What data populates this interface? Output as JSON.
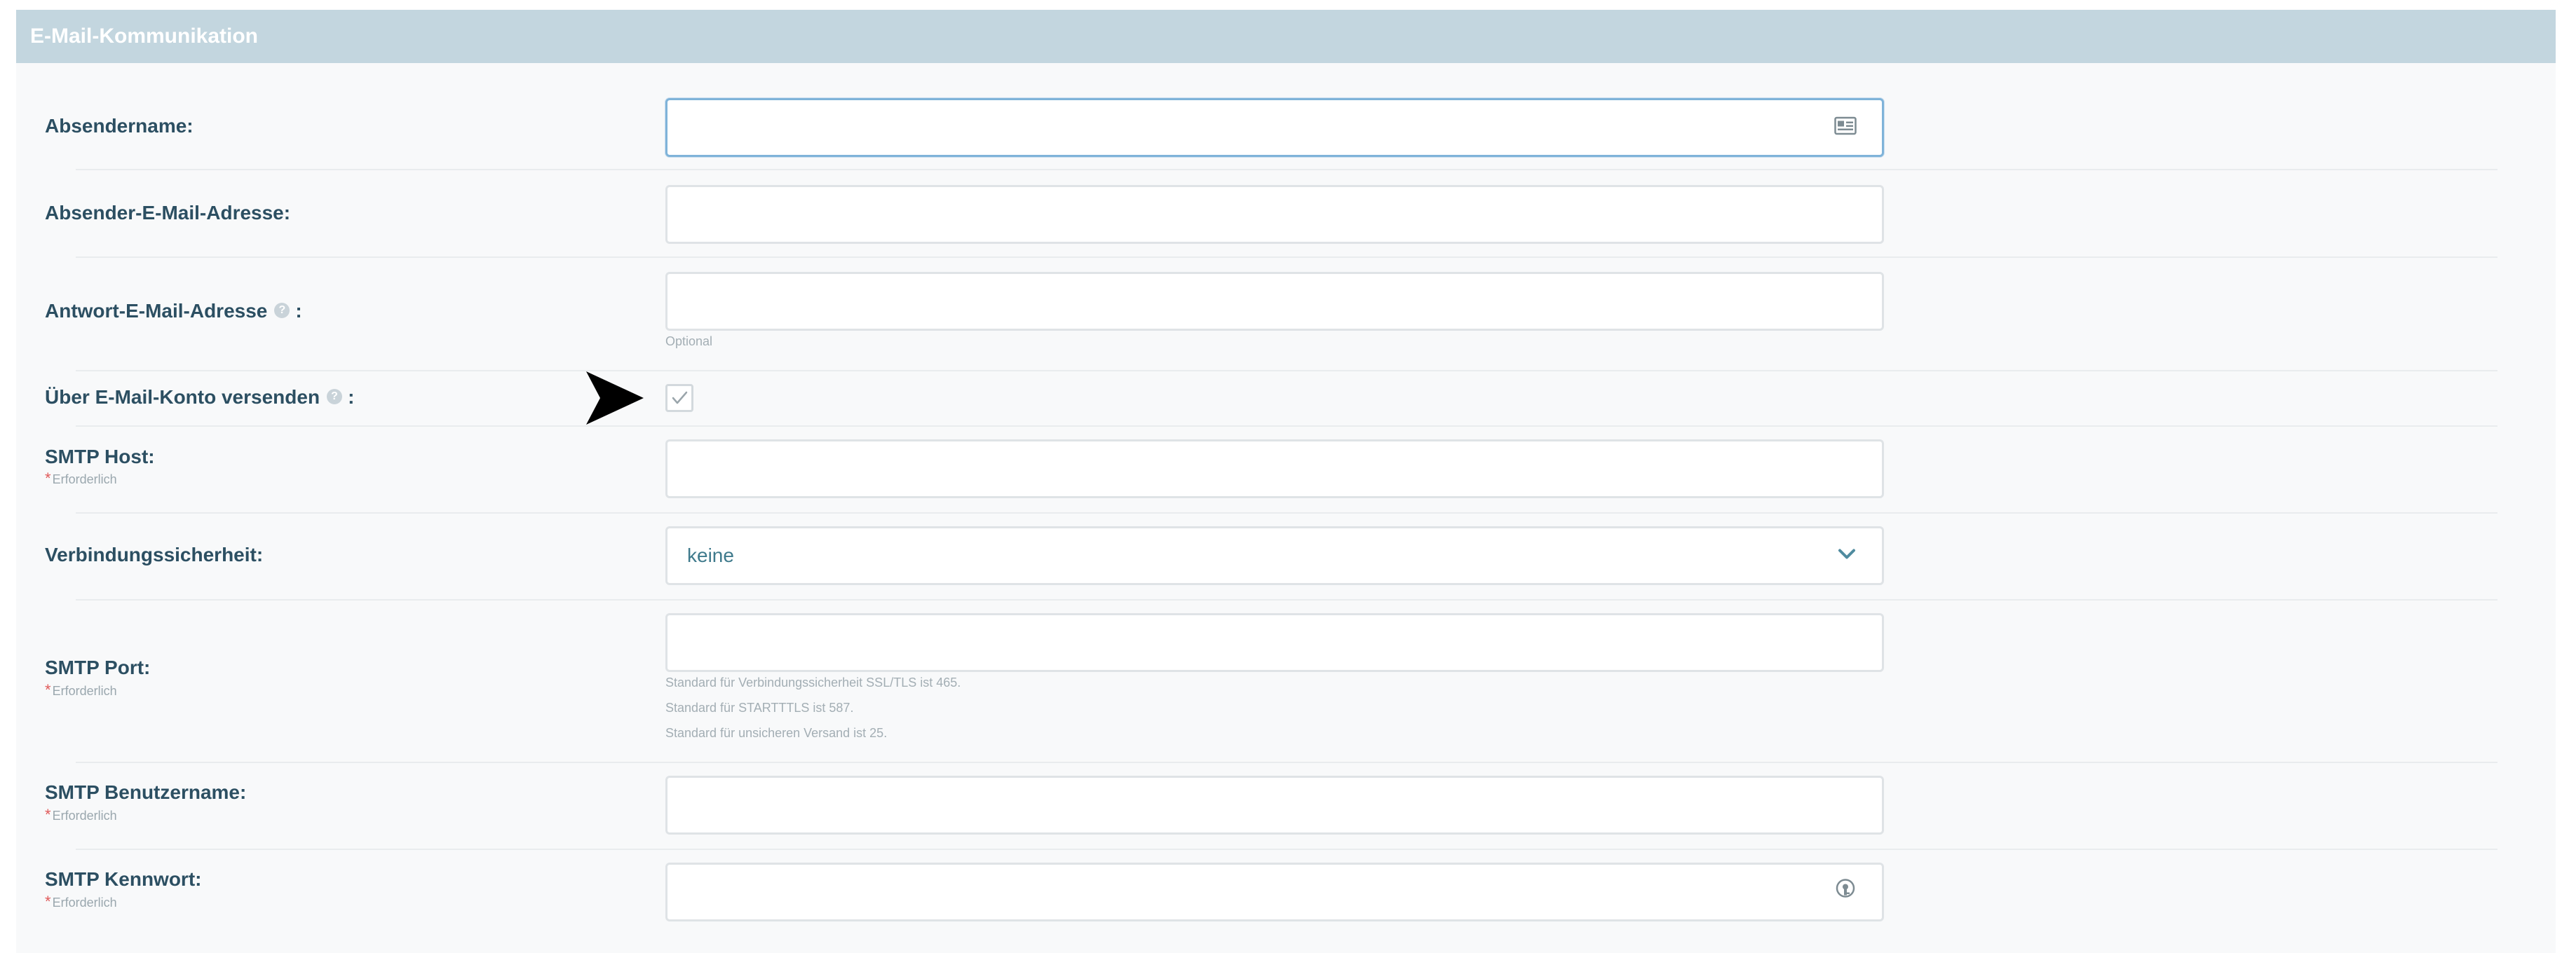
{
  "section": {
    "title": "E-Mail-Kommunikation"
  },
  "fields": {
    "sender_name": {
      "label": "Absendername:",
      "value": ""
    },
    "sender_email": {
      "label": "Absender-E-Mail-Adresse:",
      "value": ""
    },
    "reply_email": {
      "label": "Antwort-E-Mail-Adresse",
      "label_suffix": ":",
      "value": "",
      "hint": "Optional"
    },
    "send_via_account": {
      "label": "Über E-Mail-Konto versenden",
      "label_suffix": ":",
      "checked": true
    },
    "smtp_host": {
      "label": "SMTP Host:",
      "required": "Erforderlich",
      "value": ""
    },
    "connection_security": {
      "label": "Verbindungssicherheit:",
      "selected": "keine"
    },
    "smtp_port": {
      "label": "SMTP Port:",
      "required": "Erforderlich",
      "value": "",
      "hints": [
        "Standard für Verbindungssicherheit SSL/TLS ist 465.",
        "Standard für STARTTTLS ist 587.",
        "Standard für unsicheren Versand ist 25."
      ]
    },
    "smtp_username": {
      "label": "SMTP Benutzername:",
      "required": "Erforderlich",
      "value": ""
    },
    "smtp_password": {
      "label": "SMTP Kennwort:",
      "required": "Erforderlich",
      "value": ""
    }
  },
  "icons": {
    "contact_card": "contact-card-icon",
    "password_key": "password-key-icon",
    "help": "help-icon",
    "chevron": "chevron-down-icon",
    "check": "check-icon",
    "cursor": "pointer-arrow-icon"
  },
  "colors": {
    "header_bg": "#c3d6df",
    "label": "#2c4f62",
    "focus_border": "#7fb3d9",
    "required_star": "#e05a5a",
    "select_text": "#3f7a8c"
  }
}
